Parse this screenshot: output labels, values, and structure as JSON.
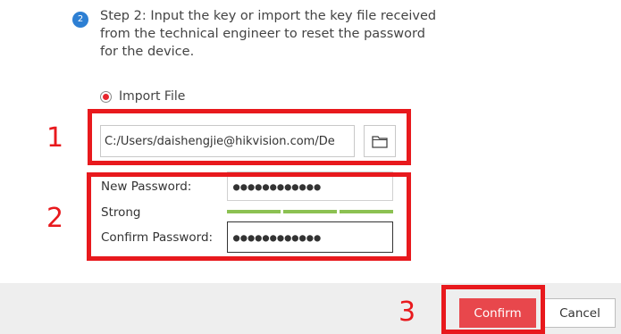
{
  "step": {
    "badge": "2",
    "text": "Step 2: Input the key or import the key file received\nfrom the technical engineer to reset the password\nfor the device."
  },
  "import": {
    "radio_label": "Import File",
    "file_path": "C:/Users/daishengjie@hikvision.com/De"
  },
  "password": {
    "new_label": "New Password:",
    "new_value": "●●●●●●●●●●●●",
    "strength_label": "Strong",
    "confirm_label": "Confirm Password:",
    "confirm_value": "●●●●●●●●●●●●",
    "strength_color": "#8cc152"
  },
  "buttons": {
    "confirm": "Confirm",
    "cancel": "Cancel"
  },
  "annotations": {
    "box1": "1",
    "box2": "2",
    "box3": "3",
    "color": "#e8191d"
  }
}
